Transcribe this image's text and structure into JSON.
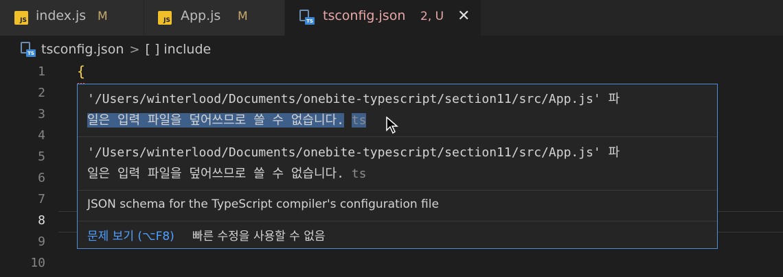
{
  "tabs": [
    {
      "icon": "js-file-icon",
      "label": "index.js",
      "status": "M"
    },
    {
      "icon": "js-file-icon",
      "label": "App.js",
      "status": "M"
    },
    {
      "icon": "ts-file-icon",
      "label": "tsconfig.json",
      "status": "2, U",
      "active": true
    }
  ],
  "icon_badges": {
    "js": "JS",
    "ts": "TS"
  },
  "close_glyph": "✕",
  "breadcrumb": {
    "file": "tsconfig.json",
    "separator": ">",
    "item": "[ ] include"
  },
  "editor": {
    "line_numbers": [
      "1",
      "2",
      "3",
      "4",
      "5",
      "6",
      "7",
      "8",
      "9",
      "10"
    ],
    "current_line": "8",
    "line1_text": "{"
  },
  "hover": {
    "problems": [
      {
        "line1": "'/Users/winterlood/Documents/onebite-typescript/section11/src/App.js' 파",
        "line2": "일은 입력 파일을 덮어쓰므로 쓸 수 없습니다.",
        "source": "ts"
      },
      {
        "line1": "'/Users/winterlood/Documents/onebite-typescript/section11/src/App.js' 파",
        "line2": "일은 입력 파일을 덮어쓰므로 쓸 수 없습니다.",
        "source": "ts"
      }
    ],
    "schema_text": "JSON schema for the TypeScript compiler's configuration file",
    "view_problem_label": "문제 보기 (⌥F8)",
    "no_quick_fix_label": "빠른 수정을 사용할 수 없음"
  },
  "colors": {
    "editor_bg": "#1e1e1e",
    "hover_border": "#4d8fd9",
    "selection": "#3e5f8a",
    "error_tab_text": "#e8a7a7",
    "modified": "#c7a86b",
    "link": "#4fa0ff"
  }
}
